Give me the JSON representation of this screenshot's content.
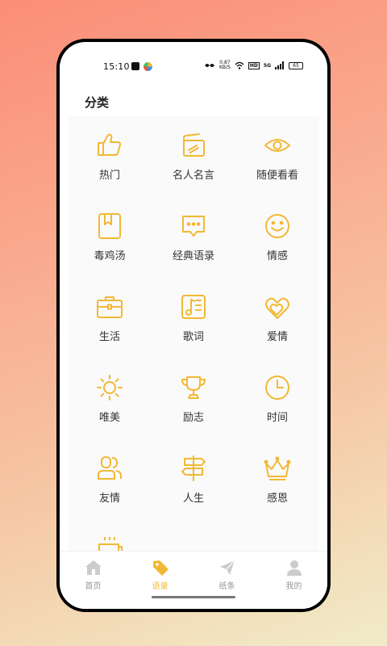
{
  "status_bar": {
    "time": "15:10",
    "net_speed_value": "0.87",
    "net_speed_unit": "KB/S",
    "hd_badge": "HD",
    "network_type": "5G",
    "battery": "65"
  },
  "page_title": "分类",
  "categories": [
    {
      "label": "热门",
      "icon": "thumbs-up-icon"
    },
    {
      "label": "名人名言",
      "icon": "cards-icon"
    },
    {
      "label": "随便看看",
      "icon": "eye-icon"
    },
    {
      "label": "毒鸡汤",
      "icon": "bookmark-book-icon"
    },
    {
      "label": "经典语录",
      "icon": "chat-bubble-icon"
    },
    {
      "label": "情感",
      "icon": "smile-icon"
    },
    {
      "label": "生活",
      "icon": "briefcase-icon"
    },
    {
      "label": "歌词",
      "icon": "music-note-icon"
    },
    {
      "label": "爱情",
      "icon": "hearts-icon"
    },
    {
      "label": "唯美",
      "icon": "sun-icon"
    },
    {
      "label": "励志",
      "icon": "trophy-icon"
    },
    {
      "label": "时间",
      "icon": "clock-icon"
    },
    {
      "label": "友情",
      "icon": "friends-icon"
    },
    {
      "label": "人生",
      "icon": "signpost-icon"
    },
    {
      "label": "感恩",
      "icon": "crown-icon"
    },
    {
      "label": "",
      "icon": "coffee-cup-icon"
    }
  ],
  "tabs": [
    {
      "label": "首页",
      "icon": "home-icon",
      "active": false
    },
    {
      "label": "语录",
      "icon": "tag-icon",
      "active": true
    },
    {
      "label": "纸条",
      "icon": "paper-plane-icon",
      "active": false
    },
    {
      "label": "我的",
      "icon": "user-icon",
      "active": false
    }
  ],
  "colors": {
    "accent": "#F2B833",
    "tab_inactive": "#CCCCCC",
    "text": "#333333"
  }
}
